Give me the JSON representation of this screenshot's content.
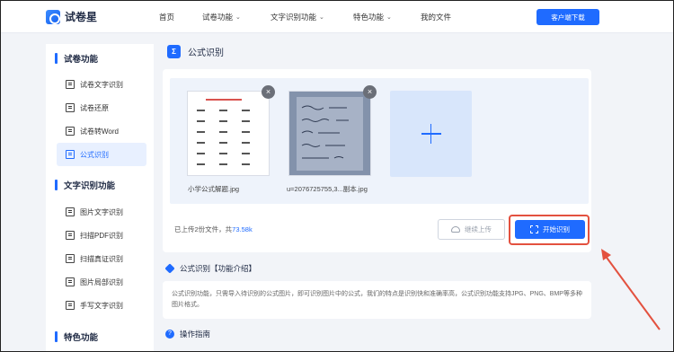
{
  "app": {
    "logo_text": "试卷星"
  },
  "nav": {
    "items": [
      {
        "label": "首页",
        "dropdown": false
      },
      {
        "label": "试卷功能",
        "dropdown": true
      },
      {
        "label": "文字识别功能",
        "dropdown": true
      },
      {
        "label": "特色功能",
        "dropdown": true
      },
      {
        "label": "我的文件",
        "dropdown": false
      }
    ],
    "download_label": "客户端下载"
  },
  "sidebar": {
    "sections": [
      {
        "heading": "试卷功能",
        "items": [
          {
            "label": "试卷文字识别",
            "icon": "document-icon",
            "active": false
          },
          {
            "label": "试卷还原",
            "icon": "document-icon",
            "active": false
          },
          {
            "label": "试卷转Word",
            "icon": "document-icon",
            "active": false
          },
          {
            "label": "公式识别",
            "icon": "image-icon",
            "active": true
          }
        ]
      },
      {
        "heading": "文字识别功能",
        "items": [
          {
            "label": "图片文字识别",
            "icon": "image-icon",
            "active": false
          },
          {
            "label": "扫描PDF识别",
            "icon": "document-icon",
            "active": false
          },
          {
            "label": "扫描真证识别",
            "icon": "document-icon",
            "active": false
          },
          {
            "label": "图片局部识别",
            "icon": "image-icon",
            "active": false
          },
          {
            "label": "手写文字识别",
            "icon": "document-icon",
            "active": false
          }
        ]
      },
      {
        "heading": "特色功能",
        "items": []
      }
    ]
  },
  "page": {
    "title_icon": "Σ",
    "title": "公式识别"
  },
  "upload": {
    "files": [
      {
        "name": "小学公式解题.jpg",
        "remove_label": "×"
      },
      {
        "name": "u=2076725755,3...副本.jpg",
        "remove_label": "×"
      }
    ],
    "status_prefix": "已上传2份文件，共",
    "total_size": "73.58k",
    "continue_label": "继续上传",
    "start_label": "开始识别"
  },
  "intro": {
    "heading": "公式识别【功能介绍】",
    "text": "公式识别功能，只需导入待识别的公式图片，即可识别图片中的公式，我们的特点是识别快和准确率高，公式识别功能支持JPG、PNG、BMP等多种图片格式。"
  },
  "guide": {
    "heading": "操作指南"
  },
  "colors": {
    "accent": "#1f6bff",
    "highlight": "#e3513f",
    "background": "#f2f4f8"
  }
}
